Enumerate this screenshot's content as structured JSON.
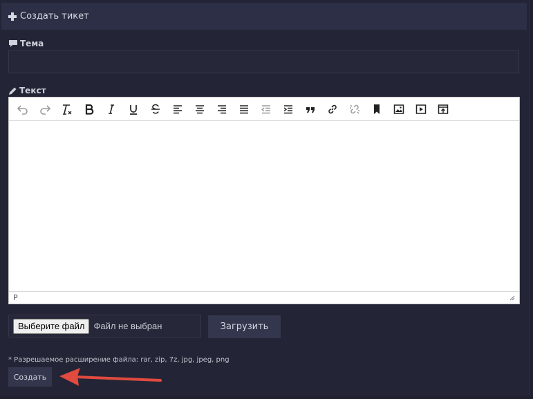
{
  "header": {
    "title": "Создать тикет"
  },
  "subject": {
    "label": "Тема",
    "value": ""
  },
  "text": {
    "label": "Текст"
  },
  "editor": {
    "toolbar": [
      "undo",
      "redo",
      "clear-formatting",
      "bold",
      "italic",
      "underline",
      "strikethrough",
      "align-left",
      "align-center",
      "align-right",
      "justify",
      "outdent",
      "indent",
      "blockquote",
      "link",
      "unlink",
      "bookmark",
      "image",
      "media",
      "template"
    ],
    "status_path": "P"
  },
  "file": {
    "choose_label": "Выберите файл",
    "status": "Файл не выбран",
    "upload_label": "Загрузить"
  },
  "hint": "* Разрешаемое расширение файла: rar, zip, 7z, jpg, jpeg, png",
  "create_label": "Создать",
  "colors": {
    "background": "#232536",
    "header": "#2c2f45",
    "button": "#33364c",
    "annotation_arrow": "#e04a3f"
  }
}
